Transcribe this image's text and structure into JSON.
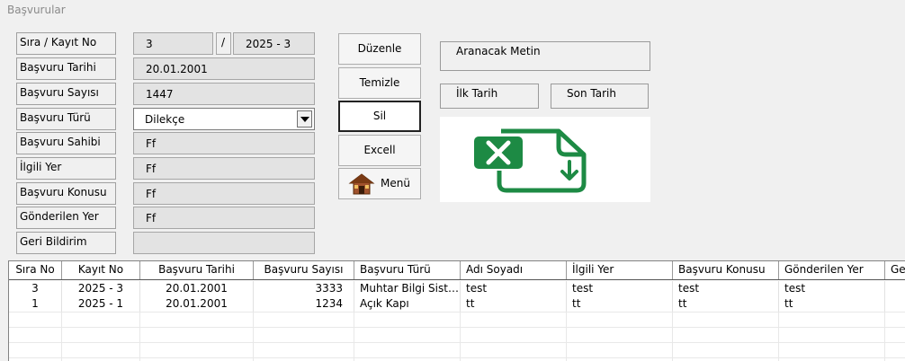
{
  "window": {
    "title": "Başvurular"
  },
  "form": {
    "labels": [
      "Sıra / Kayıt No",
      "Başvuru Tarihi",
      "Başvuru Sayısı",
      "Başvuru Türü",
      "Başvuru Sahibi",
      "İlgili Yer",
      "Başvuru Konusu",
      "Gönderilen Yer",
      "Geri Bildirim"
    ],
    "sira": "3",
    "separator": "/",
    "kayit_no": "2025 - 3",
    "basvuru_tarihi": "20.01.2001",
    "basvuru_sayisi": "1447",
    "basvuru_turu": "Dilekçe",
    "basvuru_sahibi": "Ff",
    "ilgili_yer": "Ff",
    "basvuru_konusu": "Ff",
    "gonderilen_yer": "Ff",
    "geri_bildirim": ""
  },
  "buttons": {
    "duzenle": "Düzenle",
    "temizle": "Temizle",
    "sil": "Sil",
    "excell": "Excell",
    "menu": "Menü"
  },
  "search": {
    "aranacak": "Aranacak Metin",
    "ilk_tarih": "İlk Tarih",
    "son_tarih": "Son Tarih"
  },
  "colors": {
    "excel_green": "#1d8a44",
    "header_line": "#555555"
  },
  "icons": {
    "excel": "excel-export-icon",
    "menu": "house-icon"
  },
  "table": {
    "columns": [
      "Sıra No",
      "Kayıt No",
      "Başvuru Tarihi",
      "Başvuru Sayısı",
      "Başvuru Türü",
      "Adı Soyadı",
      "İlgili Yer",
      "Başvuru Konusu",
      "Gönderilen Yer",
      "Ge"
    ],
    "rows": [
      [
        "3",
        "2025 - 3",
        "20.01.2001",
        "3333",
        "Muhtar Bilgi Sist…",
        "test",
        "test",
        "test",
        "test",
        ""
      ],
      [
        "1",
        "2025 - 1",
        "20.01.2001",
        "1234",
        "Açık Kapı",
        "tt",
        "tt",
        "tt",
        "tt",
        ""
      ]
    ]
  }
}
